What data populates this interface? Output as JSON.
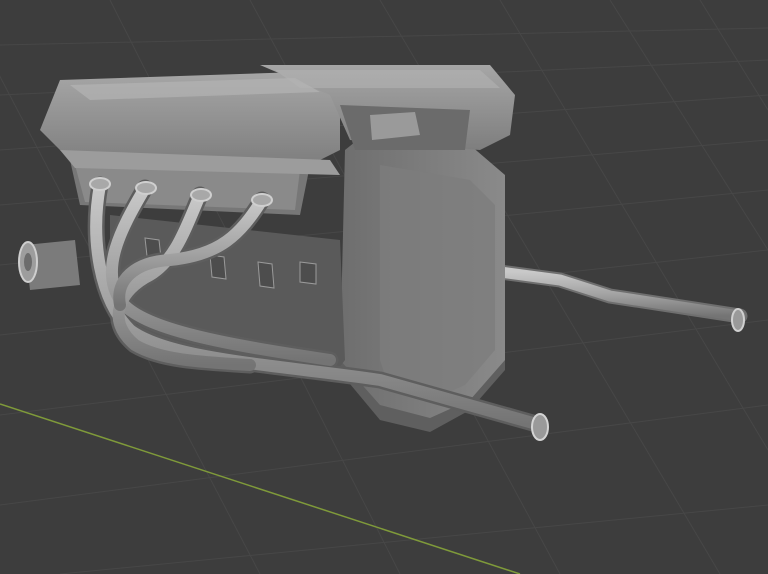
{
  "viewport": {
    "background": "#3d3d3d",
    "grid_color": "#474747",
    "x_axis_color": "#7f9a3a"
  },
  "model": {
    "name": "v8-engine-block",
    "base_color": "#8d8d8d",
    "shadow_color": "#5e5e5e",
    "highlight_color": "#b8b8b8"
  }
}
